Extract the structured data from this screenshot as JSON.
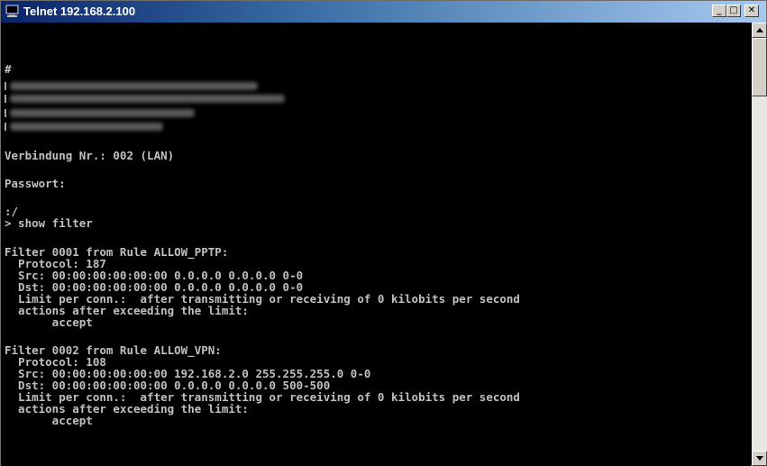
{
  "window": {
    "title": "Telnet 192.168.2.100",
    "buttons": {
      "minimize": "_",
      "maximize": "□",
      "close": "✕"
    }
  },
  "console": {
    "hash_prompt": "#",
    "connection_line": "Verbindung Nr.: 002 (LAN)",
    "password_line": "Passwort:",
    "path_prompt": ":/",
    "command_line": "> show filter",
    "filter1": {
      "header": "Filter 0001 from Rule ALLOW_PPTP:",
      "protocol": "  Protocol: 187",
      "src": "  Src: 00:00:00:00:00:00 0.0.0.0 0.0.0.0 0-0",
      "dst": "  Dst: 00:00:00:00:00:00 0.0.0.0 0.0.0.0 0-0",
      "limit": "  Limit per conn.:  after transmitting or receiving of 0 kilobits per second",
      "actions": "  actions after exceeding the limit:",
      "accept": "       accept"
    },
    "filter2": {
      "header": "Filter 0002 from Rule ALLOW_VPN:",
      "protocol": "  Protocol: 108",
      "src": "  Src: 00:00:00:00:00:00 192.168.2.0 255.255.255.0 0-0",
      "dst": "  Dst: 00:00:00:00:00:00 0.0.0.0 0.0.0.0 500-500",
      "limit": "  Limit per conn.:  after transmitting or receiving of 0 kilobits per second",
      "actions": "  actions after exceeding the limit:",
      "accept": "       accept"
    }
  },
  "icons": {
    "app": "telnet-terminal-icon"
  }
}
